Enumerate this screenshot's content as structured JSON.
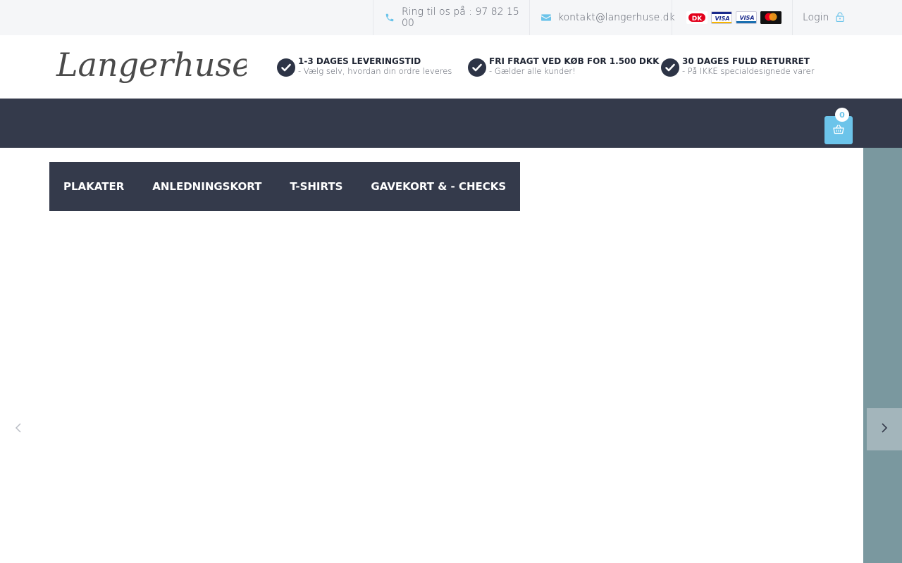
{
  "topbar": {
    "phone_text": "Ring til os på : 97 82 15 00",
    "email_text": "kontakt@langerhuse.dk",
    "login_text": "Login",
    "payment_cards": [
      "dankort",
      "visa",
      "visa-electron",
      "mastercard"
    ]
  },
  "header": {
    "logo_text": "Langerhuse",
    "usps": [
      {
        "title": "1-3 DAGES LEVERINGSTID",
        "sub": "- Vælg selv, hvordan din ordre leveres"
      },
      {
        "title": "FRI FRAGT VED KØB FOR 1.500 DKK",
        "sub": "- Gælder alle kunder!"
      },
      {
        "title": "30 DAGES FULD RETURRET",
        "sub": "- På IKKE specialdesignede varer"
      }
    ]
  },
  "cart": {
    "count": "0"
  },
  "menu": {
    "items": [
      "PLAKATER",
      "ANLEDNINGSKORT",
      "T-SHIRTS",
      "GAVEKORT & - CHECKS"
    ]
  },
  "colors": {
    "navy": "#343a4b",
    "accent": "#6cc4ea",
    "topbar_bg": "#f5f6f8",
    "slide_panel": "#7a989f"
  },
  "icons": {
    "phone": "phone-icon",
    "email": "envelope-icon",
    "login": "unlock-icon",
    "usp": "check-circle-icon",
    "cart": "basket-icon",
    "prev": "chevron-left-icon",
    "next": "chevron-right-icon"
  }
}
